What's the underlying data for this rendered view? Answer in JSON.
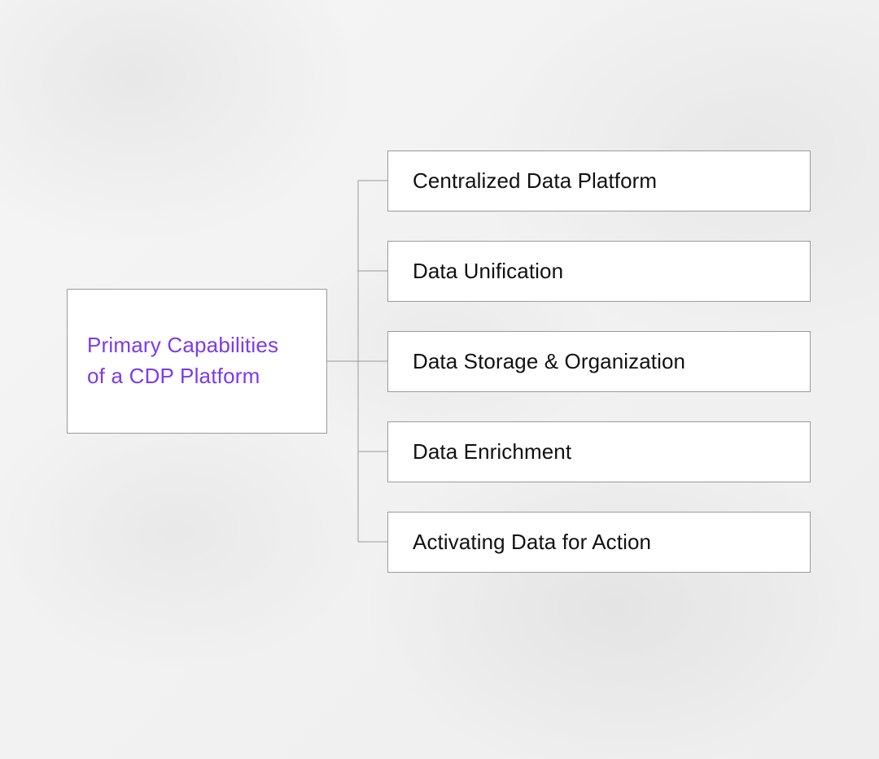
{
  "diagram": {
    "root": {
      "title_line1": "Primary Capabilities",
      "title_line2": "of a CDP Platform"
    },
    "children": [
      {
        "label": "Centralized Data Platform"
      },
      {
        "label": "Data Unification"
      },
      {
        "label": "Data Storage & Organization"
      },
      {
        "label": "Data Enrichment"
      },
      {
        "label": "Activating Data for Action"
      }
    ],
    "colors": {
      "root_text": "#7c3aed",
      "child_text": "#111111",
      "border": "#9a9a9a",
      "box_bg": "#ffffff"
    }
  }
}
